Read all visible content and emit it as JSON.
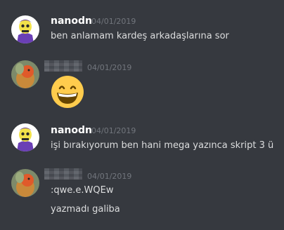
{
  "messages": [
    {
      "author": "nanodn",
      "timestamp": "04/01/2019",
      "lines": [
        "ben anlamam kardeş arkadaşlarına sor"
      ]
    },
    {
      "author": "",
      "timestamp": "04/01/2019",
      "emoji": "grinning-face-emoji"
    },
    {
      "author": "nanodn",
      "timestamp": "04/01/2019",
      "lines": [
        "işi bırakıyorum ben hani mega yazınca skript 3 ü"
      ]
    },
    {
      "author": "",
      "timestamp": "04/01/2019",
      "lines": [
        ":qwe.e.WQEw",
        "yazmadı galiba"
      ]
    }
  ],
  "colors": {
    "background": "#36393f",
    "username": "#ffffff",
    "text": "#dcddde",
    "timestamp": "#72767d"
  }
}
